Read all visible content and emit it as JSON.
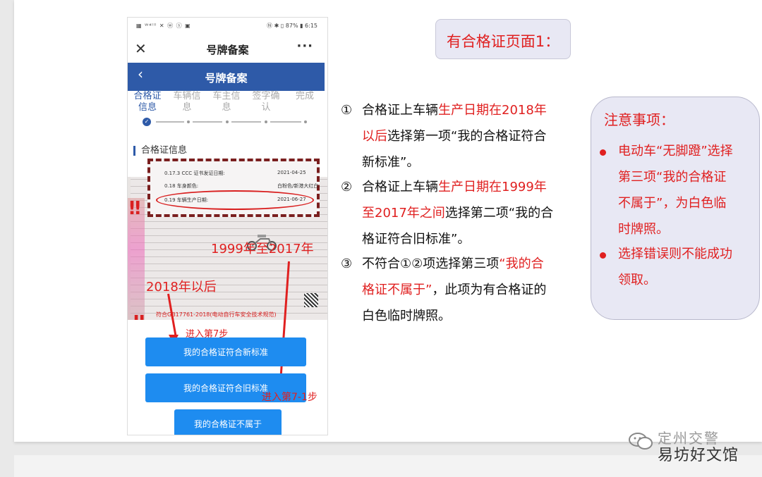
{
  "phone": {
    "status_left": "▦ ᵂ⁴ˡˡˡ ✕ ⓦ ⓢ ▣",
    "status_right": "Ⓝ ✱ ▯ 87% ▮ 6:15",
    "nav_title": "号牌备案",
    "blue_title": "号牌备案",
    "steps": [
      {
        "line1": "合格证",
        "line2": "信息",
        "active": true
      },
      {
        "line1": "车辆信",
        "line2": "息",
        "active": false
      },
      {
        "line1": "车主信",
        "line2": "息",
        "active": false
      },
      {
        "line1": "签字确",
        "line2": "认",
        "active": false
      },
      {
        "line1": "完成",
        "line2": "",
        "active": false
      }
    ],
    "section_title": "合格证信息",
    "cert_rows": [
      {
        "label": "0.17.3 CCC 证书发证日期:",
        "value": "2021-04-25"
      },
      {
        "label": "0.18 车身颜色:",
        "value": "白粉色/新港大红白"
      },
      {
        "label": "0.19 车辆生产日期:",
        "value": "2021-06-27"
      }
    ],
    "cert_footer": "符合GB17761-2018(电动自行车安全技术规范)",
    "annotations": {
      "after_2018": "2018年以后",
      "range_1999_2017": "1999年至2017年",
      "goto_step7": "进入第7步",
      "goto_step7_1": "进入第7-1步"
    },
    "buttons": {
      "new_standard": "我的合格证符合新标准",
      "old_standard": "我的合格证符合旧标准",
      "not_belong": "我的合格证不属于"
    }
  },
  "heading": "有合格证页面1：",
  "items": [
    {
      "num": "①",
      "lines": [
        [
          {
            "t": "合格证上车辆",
            "red": false
          },
          {
            "t": "生产日期在2018年",
            "red": true
          }
        ],
        [
          {
            "t": "以后",
            "red": true
          },
          {
            "t": "选择第一项“我的合格证符合",
            "red": false
          }
        ],
        [
          {
            "t": "新标准”。",
            "red": false
          }
        ]
      ]
    },
    {
      "num": "②",
      "lines": [
        [
          {
            "t": "合格证上车辆",
            "red": false
          },
          {
            "t": "生产日期在1999年",
            "red": true
          }
        ],
        [
          {
            "t": "至2017年之间",
            "red": true
          },
          {
            "t": "选择第二项“我的合",
            "red": false
          }
        ],
        [
          {
            "t": "格证符合旧标准”。",
            "red": false
          }
        ]
      ]
    },
    {
      "num": "③",
      "lines": [
        [
          {
            "t": "不符合①②项选择第三项",
            "red": false
          },
          {
            "t": "“我的合",
            "red": true
          }
        ],
        [
          {
            "t": "格证不属于”",
            "red": true
          },
          {
            "t": "，此项为有合格证的",
            "red": false
          }
        ],
        [
          {
            "t": "白色临时牌照。",
            "red": false
          }
        ]
      ]
    }
  ],
  "notice": {
    "title": "注意事项：",
    "items": [
      {
        "lines": [
          "电动车“无脚蹬”选择",
          "第三项“我的合格证",
          "不属于”，为白色临",
          "时牌照。"
        ]
      },
      {
        "lines": [
          "选择错误则不能成功",
          "领取。"
        ]
      }
    ]
  },
  "watermark": {
    "line1": "定州交警",
    "line2": "易坊好文馆"
  },
  "colors": {
    "accent_red": "#e02020",
    "phone_blue": "#2e5aa8",
    "button_blue": "#1e8cf0",
    "box_bg": "#e8e8f4"
  }
}
